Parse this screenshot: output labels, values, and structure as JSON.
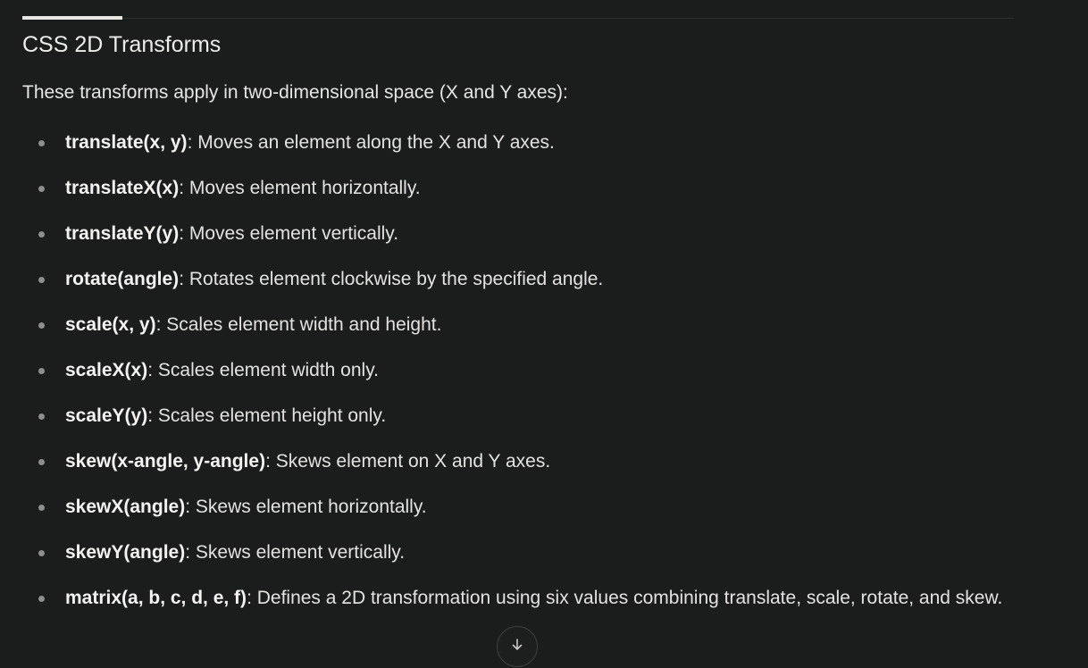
{
  "section": {
    "title": "CSS 2D Transforms",
    "intro": "These transforms apply in two-dimensional space (X and Y axes):"
  },
  "items": [
    {
      "term": "translate(x, y)",
      "desc": ": Moves an element along the X and Y axes."
    },
    {
      "term": "translateX(x)",
      "desc": ": Moves element horizontally."
    },
    {
      "term": "translateY(y)",
      "desc": ": Moves element vertically."
    },
    {
      "term": "rotate(angle)",
      "desc": ": Rotates element clockwise by the specified angle."
    },
    {
      "term": "scale(x, y)",
      "desc": ": Scales element width and height."
    },
    {
      "term": "scaleX(x)",
      "desc": ": Scales element width only."
    },
    {
      "term": "scaleY(y)",
      "desc": ": Scales element height only."
    },
    {
      "term": "skew(x-angle, y-angle)",
      "desc": ": Skews element on X and Y axes."
    },
    {
      "term": "skewX(angle)",
      "desc": ": Skews element horizontally."
    },
    {
      "term": "skewY(angle)",
      "desc": ": Skews element vertically."
    },
    {
      "term": "matrix(a, b, c, d, e, f)",
      "desc": ": Defines a 2D transformation using six values combining translate, scale, rotate, and skew."
    }
  ],
  "scroll_button": {
    "icon": "arrow-down-icon"
  },
  "colors": {
    "background": "#1b1c1c",
    "text": "#e3e3e1",
    "bullet": "#8d8e8d",
    "accent_rule": "#e6e6e4"
  }
}
